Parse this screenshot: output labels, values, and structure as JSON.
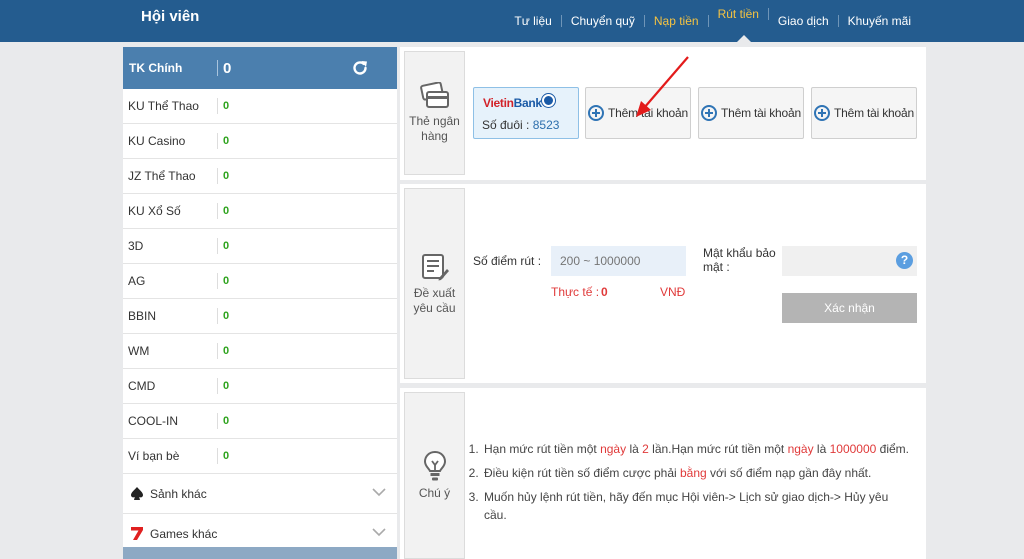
{
  "header": {
    "title": "Hội viên",
    "nav": [
      {
        "label": "Tư liệu"
      },
      {
        "label": "Chuyển quỹ"
      },
      {
        "label": "Nạp tiền"
      },
      {
        "label": "Rút tiền"
      },
      {
        "label": "Giao dịch"
      },
      {
        "label": "Khuyến mãi"
      }
    ],
    "active_tab": "Rút tiền",
    "colors": {
      "bar": "#245c8f",
      "highlight": "#f5c342"
    }
  },
  "sidebar": {
    "main_account": {
      "label": "TK Chính",
      "value": "0",
      "refresh_icon": "refresh-icon"
    },
    "accounts": [
      {
        "name": "KU Thể Thao",
        "value": "0"
      },
      {
        "name": "KU Casino",
        "value": "0"
      },
      {
        "name": "JZ Thể Thao",
        "value": "0"
      },
      {
        "name": "KU Xổ Số",
        "value": "0"
      },
      {
        "name": "3D",
        "value": "0"
      },
      {
        "name": "AG",
        "value": "0"
      },
      {
        "name": "BBIN",
        "value": "0"
      },
      {
        "name": "WM",
        "value": "0"
      },
      {
        "name": "CMD",
        "value": "0"
      },
      {
        "name": "COOL-IN",
        "value": "0"
      },
      {
        "name": "Ví bạn bè",
        "value": "0"
      }
    ],
    "groups": [
      {
        "label": "Sảnh khác",
        "icon": "spade-icon"
      },
      {
        "label": "Games khác",
        "icon": "seven-icon"
      }
    ]
  },
  "bank_section": {
    "label": "Thẻ ngân hàng",
    "bank": {
      "logo_left": "Vietin",
      "logo_right": "Bank",
      "suffix_label": "Số đuôi :",
      "suffix_value": "8523"
    },
    "add_buttons": [
      {
        "label": "Thêm tài khoản"
      },
      {
        "label": "Thêm tài khoản"
      },
      {
        "label": "Thêm tài khoản"
      }
    ]
  },
  "withdraw_section": {
    "label": "Đề xuất yêu cầu",
    "points_label": "Số điểm rút :",
    "points_placeholder": "200 ~ 1000000",
    "actual_label": "Thực tế :",
    "actual_value": "0",
    "currency": "VNĐ",
    "password_label": "Mật khẩu bảo mật :",
    "help": "?",
    "confirm_label": "Xác nhận"
  },
  "notes_section": {
    "label": "Chú ý",
    "items": [
      {
        "parts": [
          "Hạn mức rút tiền một ",
          "ngày",
          " là ",
          "2",
          " lần.Hạn mức rút tiền một ",
          "ngày",
          " là ",
          "1000000",
          " điểm."
        ]
      },
      {
        "parts": [
          "Điều kiện rút tiền số điểm cược phải ",
          "bằng",
          " với số điểm nạp gần đây nhất."
        ]
      },
      {
        "parts": [
          "Muốn hủy lệnh rút tiền, hãy đến mục Hội viên-> Lịch sử giao dịch-> Hủy yêu cầu."
        ]
      }
    ]
  }
}
